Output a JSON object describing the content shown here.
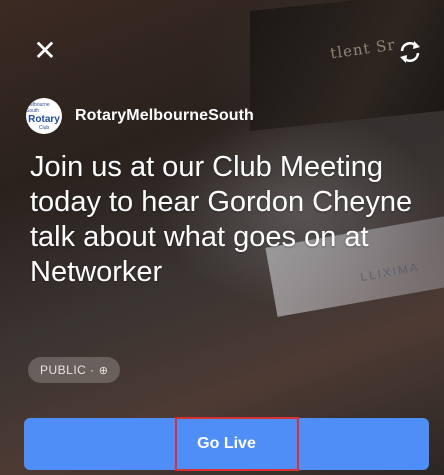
{
  "header": {
    "close_icon": "close-icon",
    "switch_camera_icon": "switch-camera-icon"
  },
  "account": {
    "avatar_top": "Melbourne South",
    "avatar_main": "Rotary",
    "avatar_sub": "Club",
    "name": "RotaryMelbourneSouth"
  },
  "post": {
    "caption": "Join us at our Club Meeting today  to hear Gordon Cheyne talk about what goes on at Networker"
  },
  "audience": {
    "label": "PUBLIC ·",
    "icon": "globe-icon"
  },
  "actions": {
    "go_live_label": "Go Live",
    "go_live_color": "#4f8ef7",
    "highlight_color": "#d93232"
  }
}
